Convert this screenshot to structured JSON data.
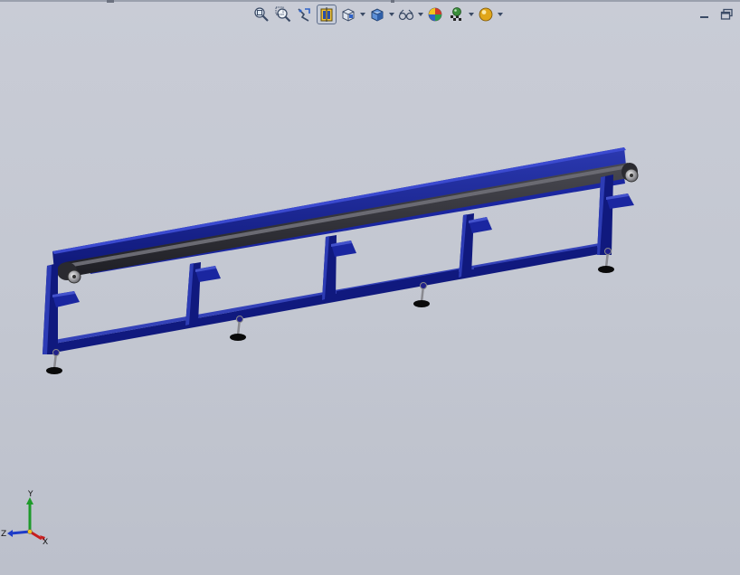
{
  "viewport": {
    "background_color": "#c6c9d3",
    "model_color": "#14208c",
    "belt_color": "#2a2a30"
  },
  "heads_up_toolbar": {
    "buttons": [
      {
        "name": "zoom-to-fit-icon",
        "icon": "magnifier-fit"
      },
      {
        "name": "zoom-to-area-icon",
        "icon": "magnifier-area"
      },
      {
        "name": "previous-view-icon",
        "icon": "arrow-back"
      },
      {
        "name": "section-view-icon",
        "icon": "section-cube",
        "active": true
      },
      {
        "name": "view-orientation-icon",
        "icon": "cube-orientation",
        "dropdown": true
      },
      {
        "name": "display-style-icon",
        "icon": "shaded-cube",
        "dropdown": true
      },
      {
        "name": "hide-show-items-icon",
        "icon": "glasses",
        "dropdown": true
      },
      {
        "name": "edit-appearance-icon",
        "icon": "color-sphere"
      },
      {
        "name": "apply-scene-icon",
        "icon": "scene-checker",
        "dropdown": true
      },
      {
        "name": "view-settings-icon",
        "icon": "gold-sphere",
        "dropdown": true
      }
    ]
  },
  "window_controls": {
    "minimize_icon": "minimize",
    "restore_icon": "restore"
  },
  "triad": {
    "x_label": "X",
    "y_label": "Y",
    "z_label": "Z",
    "x_color": "#c81e1e",
    "y_color": "#1e9a2a",
    "z_color": "#1e3cc8"
  }
}
